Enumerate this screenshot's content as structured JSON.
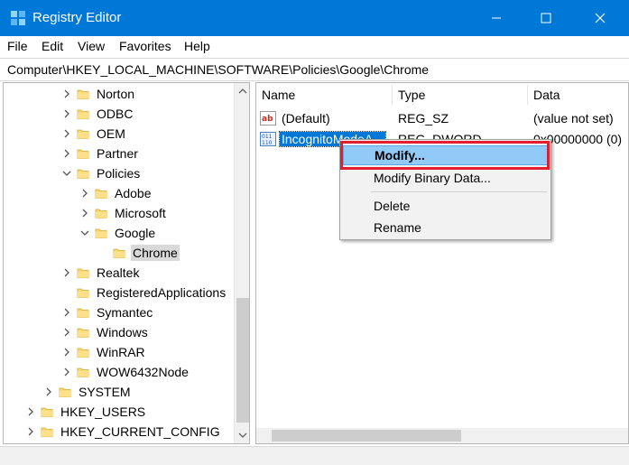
{
  "window": {
    "title": "Registry Editor",
    "accent_color": "#0078d7",
    "icons": {
      "app": "registry-icon",
      "minimize": "minimize-icon",
      "maximize": "maximize-icon",
      "close": "close-icon"
    }
  },
  "menu": [
    "File",
    "Edit",
    "View",
    "Favorites",
    "Help"
  ],
  "address": "Computer\\HKEY_LOCAL_MACHINE\\SOFTWARE\\Policies\\Google\\Chrome",
  "tree": {
    "items": [
      {
        "label": "Norton",
        "expander": "collapsed"
      },
      {
        "label": "ODBC",
        "expander": "collapsed"
      },
      {
        "label": "OEM",
        "expander": "collapsed"
      },
      {
        "label": "Partner",
        "expander": "collapsed"
      },
      {
        "label": "Policies",
        "expander": "expanded"
      },
      {
        "label": "Adobe",
        "expander": "collapsed"
      },
      {
        "label": "Microsoft",
        "expander": "collapsed"
      },
      {
        "label": "Google",
        "expander": "expanded"
      },
      {
        "label": "Chrome",
        "expander": "none",
        "selected": true
      },
      {
        "label": "Realtek",
        "expander": "collapsed"
      },
      {
        "label": "RegisteredApplications",
        "expander": "none"
      },
      {
        "label": "Symantec",
        "expander": "collapsed"
      },
      {
        "label": "Windows",
        "expander": "collapsed"
      },
      {
        "label": "WinRAR",
        "expander": "collapsed"
      },
      {
        "label": "WOW6432Node",
        "expander": "collapsed"
      },
      {
        "label": "SYSTEM",
        "expander": "collapsed"
      },
      {
        "label": "HKEY_USERS",
        "expander": "collapsed"
      },
      {
        "label": "HKEY_CURRENT_CONFIG",
        "expander": "collapsed"
      }
    ]
  },
  "list": {
    "columns": [
      "Name",
      "Type",
      "Data"
    ],
    "rows": [
      {
        "name": "(Default)",
        "type": "REG_SZ",
        "data": "(value not set)",
        "icon": "string-value-icon"
      },
      {
        "name": "IncognitoModeA...",
        "type": "REG_DWORD",
        "data": "0x00000000 (0)",
        "icon": "binary-value-icon",
        "selected": true
      }
    ]
  },
  "context_menu": {
    "items": [
      "Modify...",
      "Modify Binary Data...",
      "Delete",
      "Rename"
    ],
    "highlighted": "Modify...",
    "highlight_border_color": "#e21f2e"
  }
}
